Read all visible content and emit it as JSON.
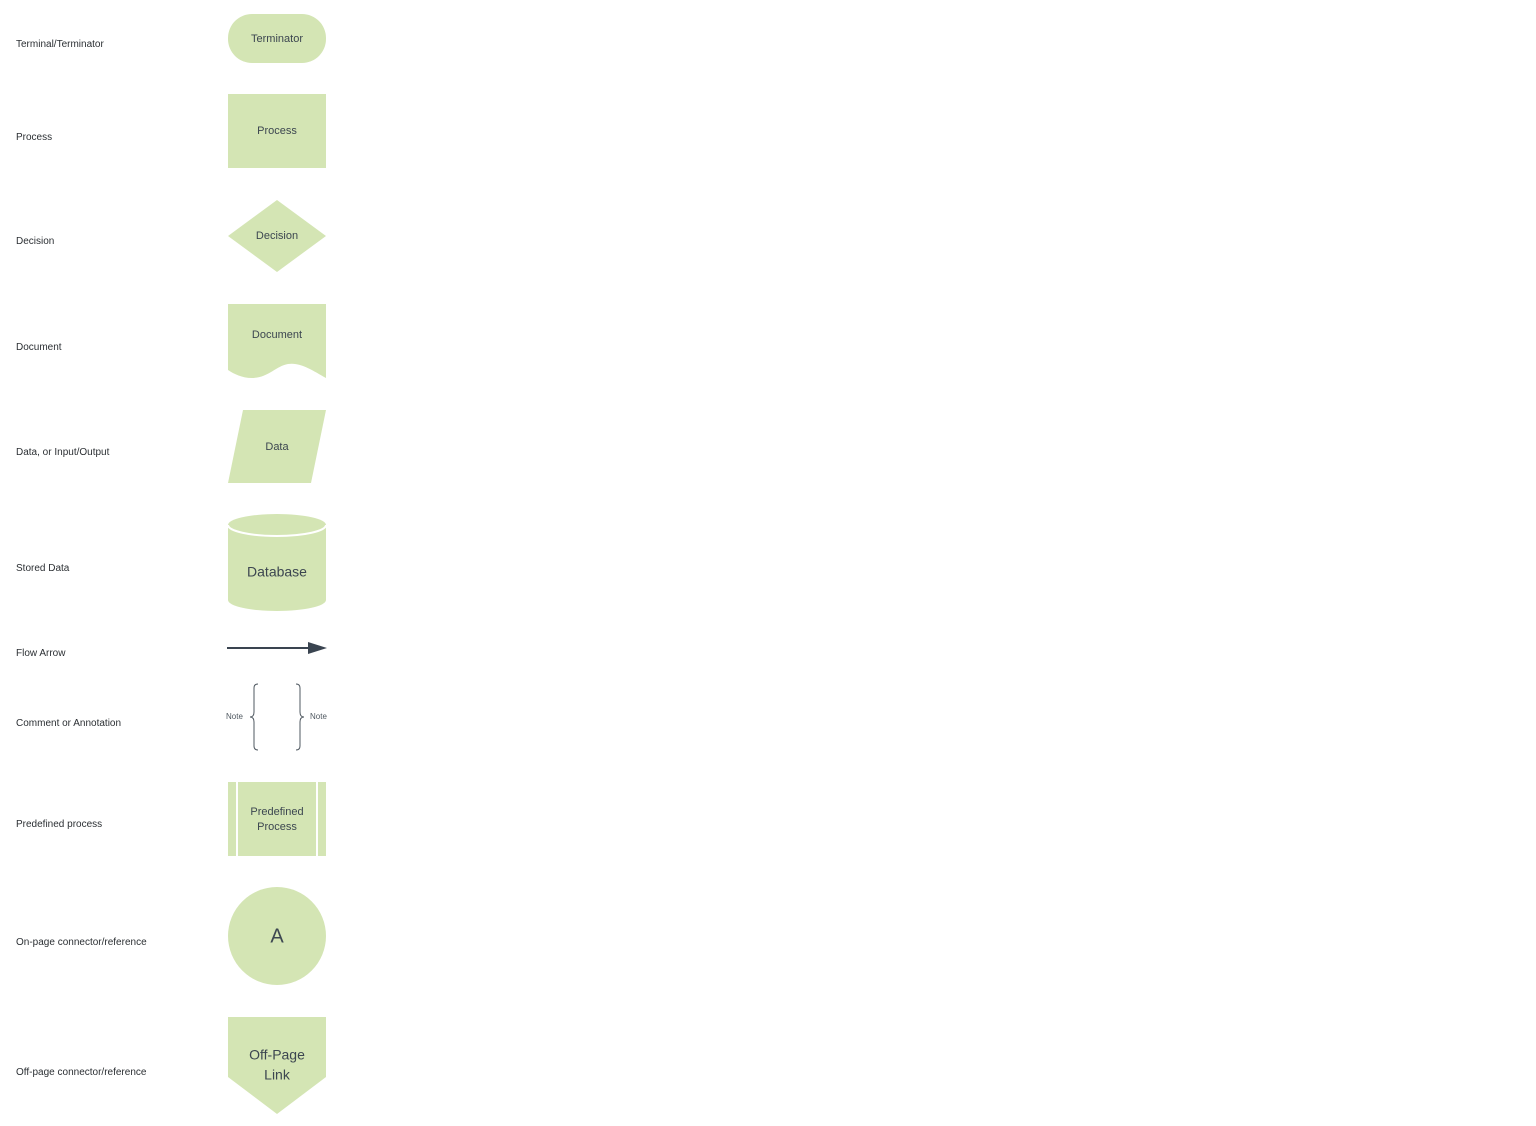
{
  "legend": {
    "rows": [
      {
        "label": "Terminal/Terminator"
      },
      {
        "label": "Process"
      },
      {
        "label": "Decision"
      },
      {
        "label": "Document"
      },
      {
        "label": "Data, or Input/Output"
      },
      {
        "label": "Stored Data"
      },
      {
        "label": "Flow Arrow"
      },
      {
        "label": "Comment or Annotation"
      },
      {
        "label": "Predefined process"
      },
      {
        "label": "On-page connector/reference"
      },
      {
        "label": "Off-page connector/reference"
      }
    ]
  },
  "shapes": {
    "terminator": {
      "text": "Terminator"
    },
    "process": {
      "text": "Process"
    },
    "decision": {
      "text": "Decision"
    },
    "document": {
      "text": "Document"
    },
    "data": {
      "text": "Data"
    },
    "database": {
      "text": "Database"
    },
    "annotation": {
      "left_note": "Note",
      "right_note": "Note"
    },
    "predefined": {
      "line1": "Predefined",
      "line2": "Process"
    },
    "onpage": {
      "text": "A"
    },
    "offpage": {
      "line1": "Off-Page",
      "line2": "Link"
    }
  },
  "colors": {
    "shape_fill": "#d4e5b4",
    "shape_text": "#3c4650",
    "arrow": "#3a4450",
    "label_text": "#2b2f33"
  }
}
